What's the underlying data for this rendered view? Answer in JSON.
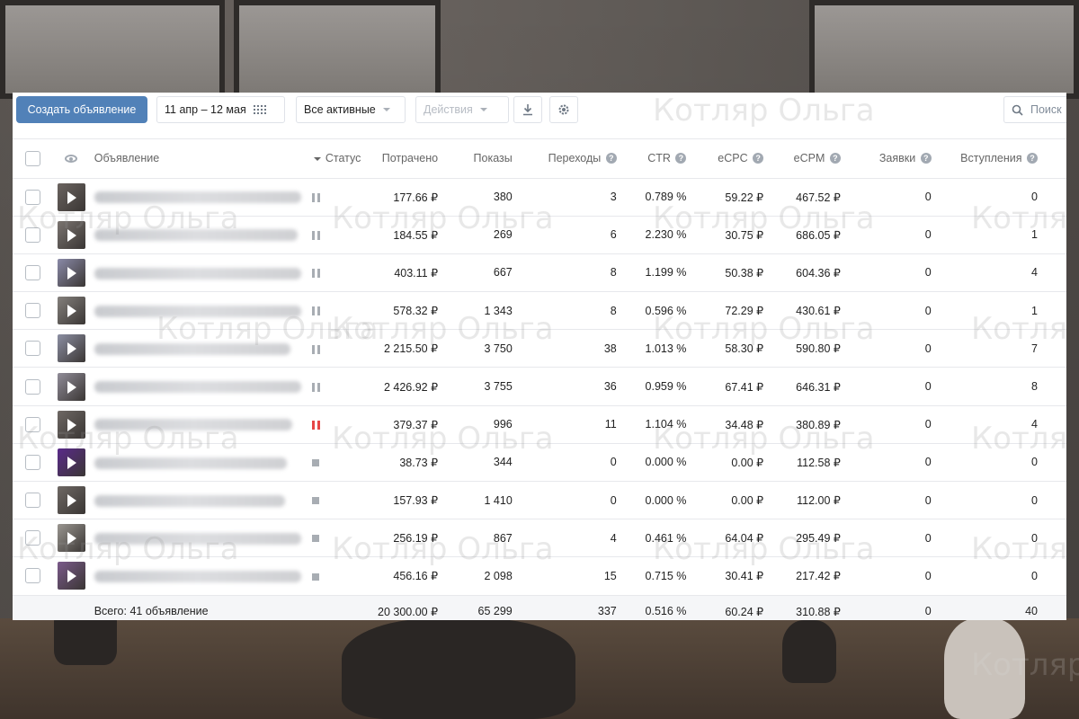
{
  "toolbar": {
    "create_label": "Создать объявление",
    "date_range": "11 апр – 12 мая",
    "filter_label": "Все активные",
    "actions_label": "Действия",
    "search_placeholder": "Поиск"
  },
  "watermark_text": "Котляр Ольга",
  "columns": {
    "ad": "Объявление",
    "status": "Статус",
    "spent": "Потрачено",
    "impressions": "Показы",
    "clicks": "Переходы",
    "ctr": "CTR",
    "ecpc": "eCPC",
    "ecpm": "eCPM",
    "leads": "Заявки",
    "joins": "Вступления"
  },
  "rows": [
    {
      "thumb_color": "#6b6460",
      "status": "paused",
      "spent": "177.66 ₽",
      "impressions": "380",
      "clicks": "3",
      "ctr": "0.789 %",
      "ecpc": "59.22 ₽",
      "ecpm": "467.52 ₽",
      "leads": "0",
      "joins": "0"
    },
    {
      "thumb_color": "#7a7470",
      "status": "paused",
      "spent": "184.55 ₽",
      "impressions": "269",
      "clicks": "6",
      "ctr": "2.230 %",
      "ecpc": "30.75 ₽",
      "ecpm": "686.05 ₽",
      "leads": "0",
      "joins": "1"
    },
    {
      "thumb_color": "#8a8aa8",
      "status": "paused",
      "spent": "403.11 ₽",
      "impressions": "667",
      "clicks": "8",
      "ctr": "1.199 %",
      "ecpc": "50.38 ₽",
      "ecpm": "604.36 ₽",
      "leads": "0",
      "joins": "4"
    },
    {
      "thumb_color": "#84807c",
      "status": "paused",
      "spent": "578.32 ₽",
      "impressions": "1 343",
      "clicks": "8",
      "ctr": "0.596 %",
      "ecpc": "72.29 ₽",
      "ecpm": "430.61 ₽",
      "leads": "0",
      "joins": "1"
    },
    {
      "thumb_color": "#8c8fa3",
      "status": "paused",
      "spent": "2 215.50 ₽",
      "impressions": "3 750",
      "clicks": "38",
      "ctr": "1.013 %",
      "ecpc": "58.30 ₽",
      "ecpm": "590.80 ₽",
      "leads": "0",
      "joins": "7"
    },
    {
      "thumb_color": "#908c98",
      "status": "paused",
      "spent": "2 426.92 ₽",
      "impressions": "3 755",
      "clicks": "36",
      "ctr": "0.959 %",
      "ecpc": "67.41 ₽",
      "ecpm": "646.31 ₽",
      "leads": "0",
      "joins": "8"
    },
    {
      "thumb_color": "#6e6864",
      "status": "paused-red",
      "spent": "379.37 ₽",
      "impressions": "996",
      "clicks": "11",
      "ctr": "1.104 %",
      "ecpc": "34.48 ₽",
      "ecpm": "380.89 ₽",
      "leads": "0",
      "joins": "4"
    },
    {
      "thumb_color": "#5a2a8a",
      "status": "stopped",
      "spent": "38.73 ₽",
      "impressions": "344",
      "clicks": "0",
      "ctr": "0.000 %",
      "ecpc": "0.00 ₽",
      "ecpm": "112.58 ₽",
      "leads": "0",
      "joins": "0"
    },
    {
      "thumb_color": "#6e6864",
      "status": "stopped",
      "spent": "157.93 ₽",
      "impressions": "1 410",
      "clicks": "0",
      "ctr": "0.000 %",
      "ecpc": "0.00 ₽",
      "ecpm": "112.00 ₽",
      "leads": "0",
      "joins": "0"
    },
    {
      "thumb_color": "#9a9690",
      "status": "stopped",
      "spent": "256.19 ₽",
      "impressions": "867",
      "clicks": "4",
      "ctr": "0.461 %",
      "ecpc": "64.04 ₽",
      "ecpm": "295.49 ₽",
      "leads": "0",
      "joins": "0"
    },
    {
      "thumb_color": "#7a5a8a",
      "status": "stopped",
      "spent": "456.16 ₽",
      "impressions": "2 098",
      "clicks": "15",
      "ctr": "0.715 %",
      "ecpc": "30.41 ₽",
      "ecpm": "217.42 ₽",
      "leads": "0",
      "joins": "0"
    }
  ],
  "totals": {
    "label": "Всего: 41 объявление",
    "spent": "20 300.00 ₽",
    "impressions": "65 299",
    "clicks": "337",
    "ctr": "0.516 %",
    "ecpc": "60.24 ₽",
    "ecpm": "310.88 ₽",
    "leads": "0",
    "joins": "40"
  },
  "colors": {
    "primary": "#5181b8",
    "paused_red": "#e64646"
  }
}
